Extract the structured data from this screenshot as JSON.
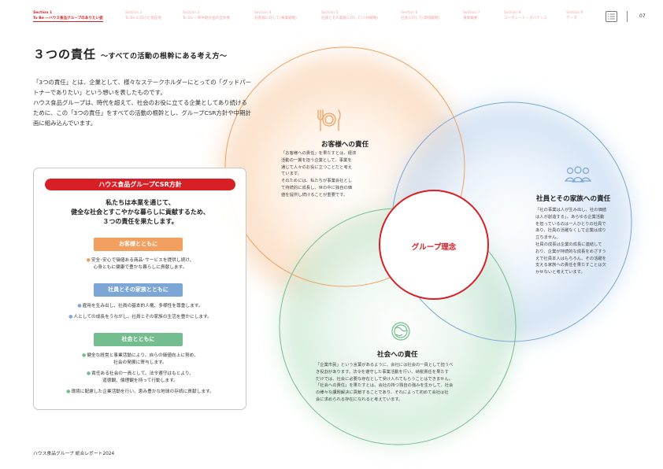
{
  "nav": {
    "sections": [
      {
        "no": "Section 1",
        "title": "To Be ―ハウス食品グループのありたい姿",
        "active": true
      },
      {
        "no": "Section 2",
        "title": "To Be に向けた現在地",
        "active": false
      },
      {
        "no": "Section 3",
        "title": "To Do ―新中期計画の全体像",
        "active": false
      },
      {
        "no": "Section 4",
        "title": "お客様に対して(事業戦略)",
        "active": false
      },
      {
        "no": "Section 5",
        "title": "社員とその家族に対して(人材戦略)",
        "active": false
      },
      {
        "no": "Section 6",
        "title": "社会に対して(環境戦略)",
        "active": false
      },
      {
        "no": "Section 7",
        "title": "事業概要",
        "active": false
      },
      {
        "no": "Section 8",
        "title": "コーポレート・ガバナンス",
        "active": false
      },
      {
        "no": "Section 9",
        "title": "データ",
        "active": false
      }
    ],
    "page_number": "07"
  },
  "title": {
    "main": "３つの責任",
    "sub": "～すべての活動の根幹にある考え方～"
  },
  "intro": [
    "「3つの責任」とは、企業として、様々なステークホルダーにとっての「グッドパートナーでありたい」という想いを表したものです。",
    "ハウス食品グループは、時代を超えて、社会のお役に立てる企業としてあり続けるために、この「3つの責任」をすべての活動の根幹とし、グループCSR方針や中期計画に組み込んでいます。"
  ],
  "venn": {
    "customer": {
      "heading": "お客様への責任",
      "lines": [
        "「お客様への責任」を果たすとは、経済",
        "活動の一翼を担う企業として、事業を",
        "通じて人々のお役に立つことだと考え",
        "ています。",
        "そのためには、私たちが事業会社とし",
        "て持続的に成長し、世の中に独自の価",
        "値を提供し続けることが重要です。"
      ]
    },
    "employees": {
      "heading": "社員とその家族への責任",
      "lines": [
        "「社の事業は人が生み出し、社の価値",
        "は人が創造する」。あらゆる企業活動",
        "を担っているのは一人ひとりの社員で",
        "あり、社員の活躍なくして企業は成り",
        "立ちません。",
        "社員の成長は企業の成長に連結して",
        "おり、企業が持続的な成長をめざすう",
        "えで社員本人はもちろん、その活躍を",
        "支える家族への責任を果たすことは欠",
        "かせないと考えています。"
      ]
    },
    "society": {
      "heading": "社会への責任",
      "lines": [
        "「企業市民」という言葉があるように、会社には社会の一員として担うべ",
        "き役割があります。法令を遵守した事業活動を行い、納税責任を果たす",
        "だけでは、社会に必要な存在として受け入れてもらうことはできません。",
        "「社会への責任」を果たすとは、会社の持つ独自の強みを生かして、社会",
        "の様々な課題解決に貢献することであり、それによって初めて会社は社",
        "会に求められる存在になれると考えています。"
      ]
    },
    "center": "グループ理念"
  },
  "policy": {
    "heading": "ハウス食品グループCSR方針",
    "lead": [
      "私たちは本業を通じて、",
      "健全な社会とすこやかな暮らしに貢献するため、",
      "３つの責任を果たします。"
    ],
    "groups": [
      {
        "label": "お客様とともに",
        "items": [
          [
            "安全･安心で価値ある商品･サービスを提供し続け、",
            "心身ともに健康で豊かな暮らしに貢献します。"
          ]
        ]
      },
      {
        "label": "社員とその家族とともに",
        "items": [
          [
            "雇用を生み出し、社員の基本的人権、多様性を尊重します。"
          ],
          [
            "人としての成長をうながし、社員とその家族の生活を豊かにします。"
          ]
        ]
      },
      {
        "label": "社会とともに",
        "items": [
          [
            "健全な経営と事業活動により、自らの価値向上に努め、",
            "社会の発展に寄与します。"
          ],
          [
            "責任ある社会の一員として、法令遵守はもとより、",
            "道徳観、倫理観を持って行動します。"
          ],
          [
            "環境に配慮した企業活動を行い、恵み豊かな地球の存続に貢献します。"
          ]
        ]
      }
    ]
  },
  "footer": "ハウス食品グループ 統合レポート2024",
  "colors": {
    "accent": "#d81f26",
    "customer": "#f2a060",
    "employees": "#7ba6d6",
    "society": "#74bd8e"
  }
}
